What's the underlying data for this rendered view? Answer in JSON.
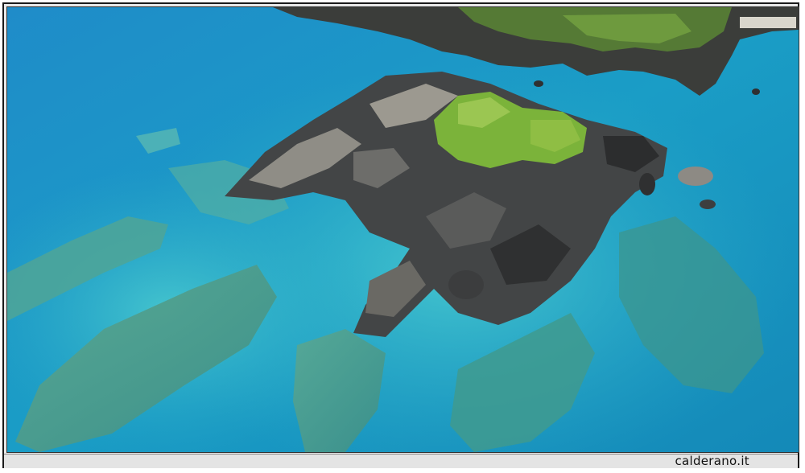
{
  "caption": {
    "watermark": "calderano.it"
  },
  "photo": {
    "subject": "aerial-sea-rocks",
    "colors": {
      "deep_water": "#1e86c4",
      "mid_water": "#1ea3c8",
      "shallow_water": "#3fc3cf",
      "reef": "#4a9e8e",
      "rock_dark": "#3a3b3c",
      "rock_light": "#8a8a84",
      "vegetation": "#7bb33a"
    }
  }
}
